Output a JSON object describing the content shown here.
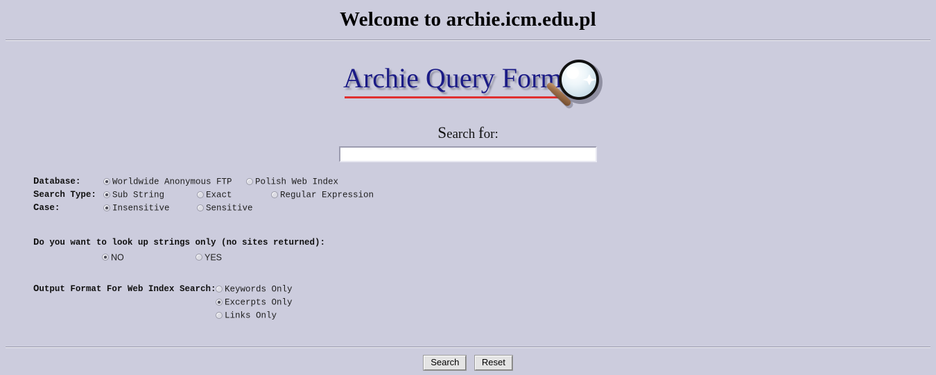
{
  "page": {
    "title": "Welcome to archie.icm.edu.pl",
    "logo_text": "Archie Query Form"
  },
  "search": {
    "label_cap": "S",
    "label_rest": "earch ",
    "label_cap2": "f",
    "label_rest2": "or:",
    "label_full": "Search for:",
    "value": "",
    "placeholder": ""
  },
  "options": {
    "database": {
      "label_cap": "D",
      "label_rest": "atabase:",
      "choices": [
        {
          "label": "Worldwide Anonymous FTP",
          "checked": true
        },
        {
          "label": "Polish Web Index",
          "checked": false
        }
      ]
    },
    "search_type": {
      "label_cap": "S",
      "label_rest": "earch Type:",
      "choices": [
        {
          "label": "Sub String",
          "checked": true
        },
        {
          "label": "Exact",
          "checked": false
        },
        {
          "label": "Regular Expression",
          "checked": false
        }
      ]
    },
    "case": {
      "label_cap": "C",
      "label_rest": "ase:",
      "choices": [
        {
          "label": "Insensitive",
          "checked": true
        },
        {
          "label": "Sensitive",
          "checked": false
        }
      ]
    }
  },
  "strings_only": {
    "question_cap": "D",
    "question_rest": "o you want to look up strings only (no sites returned):",
    "question_full": "Do you want to look up strings only (no sites returned):",
    "choices": [
      {
        "label": "NO",
        "checked": true
      },
      {
        "label": "YES",
        "checked": false
      }
    ]
  },
  "output_format": {
    "label_cap": "O",
    "label_rest": "utput Format For Web Index Search:",
    "label_full": "Output Format For Web Index Search:",
    "choices": [
      {
        "label": "Keywords Only",
        "checked": false
      },
      {
        "label": "Excerpts Only",
        "checked": true
      },
      {
        "label": "Links Only",
        "checked": false
      }
    ]
  },
  "buttons": {
    "search": "Search",
    "reset": "Reset"
  },
  "icons": {
    "magnifier": "magnifying-glass-icon"
  },
  "colors": {
    "background": "#ccccdd",
    "logo_text": "#1b1b86",
    "logo_underline": "#e03030",
    "text": "#101010"
  }
}
